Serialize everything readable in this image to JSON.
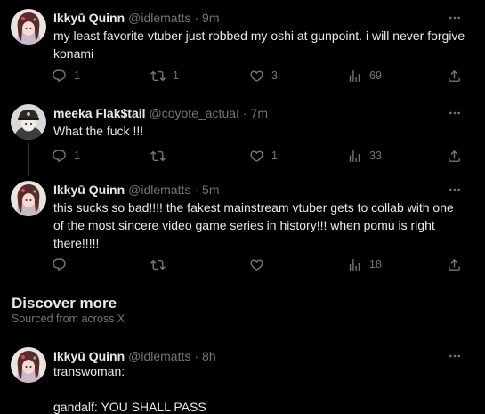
{
  "tweets": [
    {
      "name": "Ikkyū Quinn",
      "handle": "@idlematts",
      "time": "9m",
      "text_lines": [
        "my least favorite vtuber just robbed my oshi at gunpoint. i will never forgive",
        "konami"
      ],
      "replies": "1",
      "retweets": "1",
      "likes": "3",
      "views": "69"
    },
    {
      "name": "meeka Flak$tail",
      "handle": "@coyote_actuaI",
      "time": "7m",
      "text_lines": [
        "What the fuck !!!"
      ],
      "replies": "1",
      "retweets": "",
      "likes": "1",
      "views": "33"
    },
    {
      "name": "Ikkyū Quinn",
      "handle": "@idlematts",
      "time": "5m",
      "text_lines": [
        "this sucks so bad!!!! the fakest mainstream vtuber gets to collab with one",
        "of the most sincere video game series in history!!! when pomu is right",
        "there!!!!!"
      ],
      "replies": "",
      "retweets": "",
      "likes": "",
      "views": "18"
    },
    {
      "name": "Ikkyū Quinn",
      "handle": "@idlematts",
      "time": "8h",
      "text_lines": [
        "transwoman:",
        "",
        "gandalf: YOU SHALL PASS"
      ]
    }
  ],
  "discover": {
    "title": "Discover more",
    "subtitle": "Sourced from across X"
  },
  "icons": {
    "reply": "reply-icon",
    "retweet": "retweet-icon",
    "like": "heart-icon",
    "views": "views-icon",
    "share": "share-icon",
    "more": "more-icon"
  },
  "colors": {
    "background": "#000000",
    "text": "#e7e9ea",
    "muted": "#71767b",
    "divider": "#2f3336"
  }
}
